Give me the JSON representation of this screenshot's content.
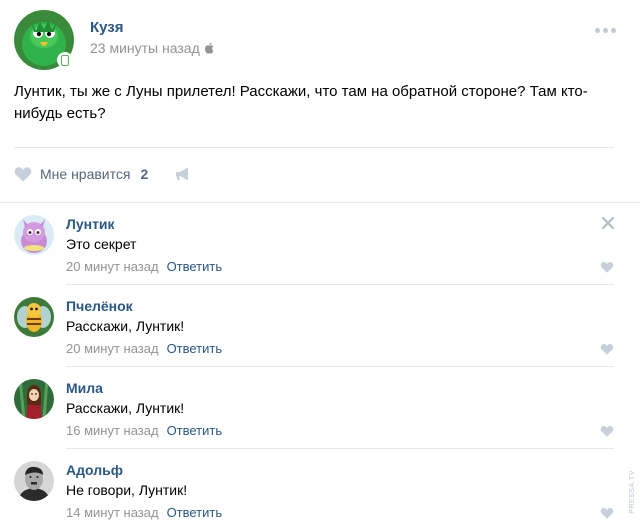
{
  "post": {
    "author": "Кузя",
    "time": "23 минуты назад",
    "text": "Лунтик, ты же с Луны прилетел! Расскажи, что там на обратной стороне? Там кто-нибудь есть?",
    "like_label": "Мне нравится",
    "like_count": "2"
  },
  "reply_label": "Ответить",
  "comments": [
    {
      "author": "Лунтик",
      "text": "Это секрет",
      "time": "20 минут назад"
    },
    {
      "author": "Пчелёнок",
      "text": "Расскажи, Лунтик!",
      "time": "20 минут назад"
    },
    {
      "author": "Мила",
      "text": "Расскажи, Лунтик!",
      "time": "16 минут назад"
    },
    {
      "author": "Адольф",
      "text": "Не говори, Лунтик!",
      "time": "14 минут назад"
    }
  ],
  "watermark": "PRESSA.TV",
  "colors": {
    "link": "#2a5885",
    "muted": "#939393",
    "icon": "#c5cbd3",
    "divider": "#e7e8ec"
  },
  "icons": [
    "mobile-icon",
    "apple-icon",
    "more-icon",
    "heart-icon",
    "share-icon",
    "close-icon"
  ]
}
